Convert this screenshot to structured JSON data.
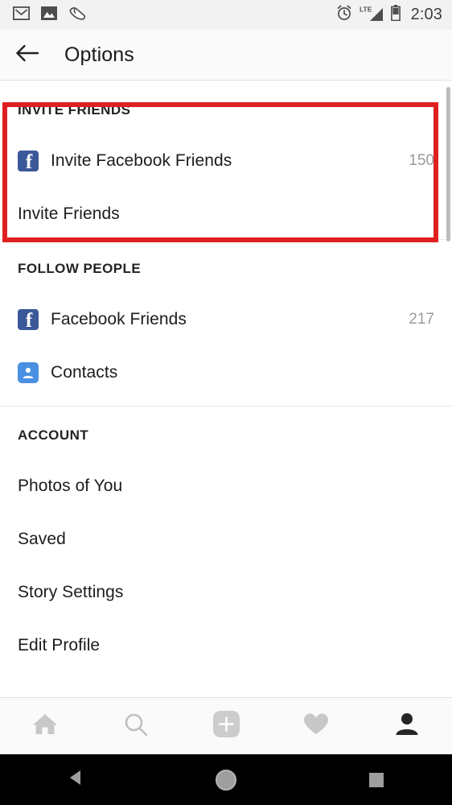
{
  "status_bar": {
    "icons_left": [
      "gmail-icon",
      "photos-icon",
      "shoe-tag-icon"
    ],
    "icons_right": [
      "alarm-icon",
      "lte-signal-icon",
      "battery-icon"
    ],
    "network_label": "LTE",
    "time": "2:03"
  },
  "app_bar": {
    "back_icon": "back-arrow-icon",
    "title": "Options"
  },
  "sections": [
    {
      "header": "INVITE FRIENDS",
      "highlighted": true,
      "rows": [
        {
          "label": "Invite Facebook Friends",
          "icon": "facebook-icon",
          "count": "150"
        },
        {
          "label": "Invite Friends",
          "icon": null,
          "count": ""
        }
      ]
    },
    {
      "header": "FOLLOW PEOPLE",
      "highlighted": false,
      "rows": [
        {
          "label": "Facebook Friends",
          "icon": "facebook-icon",
          "count": "217"
        },
        {
          "label": "Contacts",
          "icon": "contacts-icon",
          "count": ""
        }
      ]
    },
    {
      "header": "ACCOUNT",
      "highlighted": false,
      "rows": [
        {
          "label": "Photos of You",
          "icon": null,
          "count": ""
        },
        {
          "label": "Saved",
          "icon": null,
          "count": ""
        },
        {
          "label": "Story Settings",
          "icon": null,
          "count": ""
        },
        {
          "label": "Edit Profile",
          "icon": null,
          "count": ""
        }
      ]
    }
  ],
  "tab_bar": {
    "tabs": [
      {
        "name": "home-tab",
        "icon": "home-icon",
        "active": false
      },
      {
        "name": "search-tab",
        "icon": "search-icon",
        "active": false
      },
      {
        "name": "add-post-tab",
        "icon": "plus-square-icon",
        "active": false
      },
      {
        "name": "activity-tab",
        "icon": "heart-icon",
        "active": false
      },
      {
        "name": "profile-tab",
        "icon": "person-icon",
        "active": true
      }
    ]
  },
  "nav_bar": {
    "buttons": [
      {
        "name": "android-back-button",
        "icon": "triangle-left-icon"
      },
      {
        "name": "android-home-button",
        "icon": "circle-icon"
      },
      {
        "name": "android-recents-button",
        "icon": "square-icon"
      }
    ]
  },
  "colors": {
    "highlight_red": "#e02020",
    "facebook_blue": "#3b5998",
    "contacts_blue": "#4a90e2",
    "count_grey": "#9b9b9b",
    "status_bar_bg": "#f2f2f2",
    "app_bar_bg": "#fafafa"
  }
}
